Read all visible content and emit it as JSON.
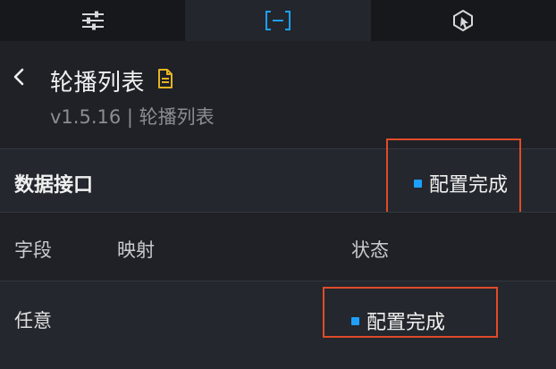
{
  "tabs": [
    {
      "icon": "sliders-icon",
      "active": false
    },
    {
      "icon": "bracket-minus-icon",
      "active": true
    },
    {
      "icon": "cursor-shape-icon",
      "active": false
    }
  ],
  "header": {
    "title": "轮播列表",
    "subtitle": "v1.5.16 | 轮播列表"
  },
  "data_interface": {
    "label": "数据接口",
    "status": "配置完成"
  },
  "table": {
    "columns": [
      "字段",
      "映射",
      "状态"
    ],
    "rows": [
      {
        "field": "任意",
        "mapping": "",
        "status": "配置完成"
      }
    ]
  },
  "colors": {
    "accent": "#1e9fff",
    "highlight": "#e04b2a",
    "doc_icon": "#e6b422"
  }
}
